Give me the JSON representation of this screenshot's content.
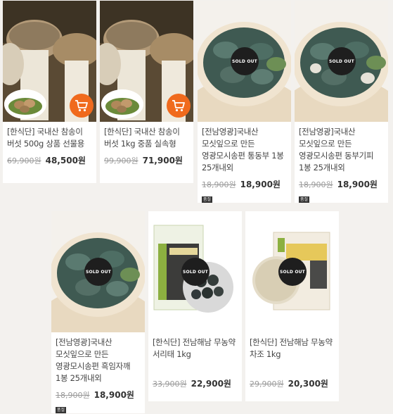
{
  "products": [
    {
      "name": "[한식단] 국내산 참송이 버섯 500g 상품 선물용",
      "old_price": "69,900원",
      "price": "48,500원",
      "sold_out": "",
      "badge": ""
    },
    {
      "name": "[한식단] 국내산 참송이 버섯 1kg 중품 실속형",
      "old_price": "99,900원",
      "price": "71,900원",
      "sold_out": "",
      "badge": ""
    },
    {
      "name": "[전남영광]국내산 모싯잎으로 만든 영광모시송편 통동부 1봉 25개내외",
      "old_price": "18,900원",
      "price": "18,900원",
      "sold_out": "SOLD OUT",
      "badge": "품절"
    },
    {
      "name": "[전남영광]국내산 모싯잎으로 만든 영광모시송편 동부기피 1봉 25개내외",
      "old_price": "18,900원",
      "price": "18,900원",
      "sold_out": "SOLD OUT",
      "badge": "품절"
    },
    {
      "name": "[전남영광]국내산 모싯잎으로 만든 영광모시송편 흑임자깨 1봉 25개내외",
      "old_price": "18,900원",
      "price": "18,900원",
      "sold_out": "SOLD OUT",
      "badge": "품절"
    },
    {
      "name": "[한식단] 전남해남 무농약 서리태 1kg",
      "old_price": "33,900원",
      "price": "22,900원",
      "sold_out": "SOLD OUT",
      "badge": ""
    },
    {
      "name": "[한식단] 전남해남 무농약 차조 1kg",
      "old_price": "29,900원",
      "price": "20,300원",
      "sold_out": "SOLD OUT",
      "badge": ""
    }
  ],
  "icons": {
    "cart": "cart-icon"
  },
  "colors": {
    "cart_button": "#f06a1d",
    "sold_out_circle": "#1e1e1e",
    "background": "#f3f1ee"
  }
}
